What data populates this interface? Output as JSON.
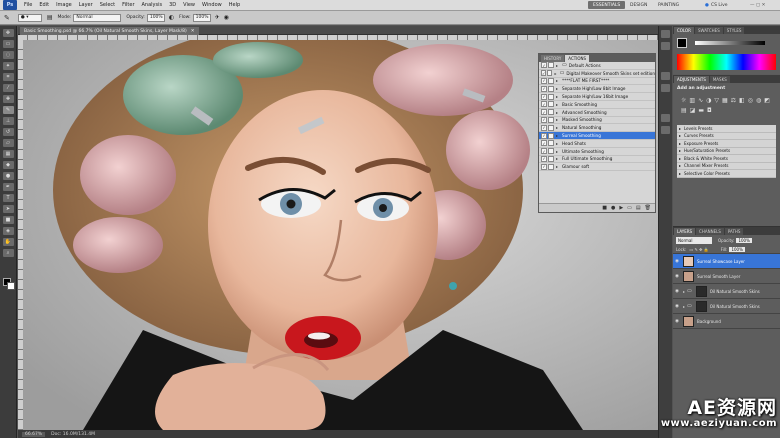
{
  "app": {
    "logo": "Ps",
    "menu": [
      "File",
      "Edit",
      "Image",
      "Layer",
      "Select",
      "Filter",
      "Analysis",
      "3D",
      "View",
      "Window",
      "Help"
    ],
    "workspaces": [
      "ESSENTIALS",
      "DESIGN",
      "PAINTING"
    ],
    "cs_live": "CS Live"
  },
  "options": {
    "mode_label": "Mode:",
    "mode_value": "Normal",
    "opacity_label": "Opacity:",
    "opacity_value": "100%",
    "flow_label": "Flow:",
    "flow_value": "100%"
  },
  "document": {
    "tab_title": "Basic Smoothing.psd @ 66.7% (Oil Natural Smooth Skins, Layer Mask/8)",
    "status_zoom": "66.67%",
    "status_doc": "Doc: 16.0M/131.4M"
  },
  "actions_panel": {
    "tabs": [
      "HISTORY",
      "ACTIONS"
    ],
    "rows": [
      {
        "label": "Default Actions",
        "checked": true,
        "folder": true
      },
      {
        "label": "Digital Makeover Smooth Skins set edition",
        "checked": true,
        "folder": true
      },
      {
        "label": "****FLAT ME FIRST****",
        "checked": true,
        "folder": false
      },
      {
        "label": "Separate High/Low 8bit Image",
        "checked": true,
        "folder": false
      },
      {
        "label": "Separate High/Low 16bit Image",
        "checked": true,
        "folder": false
      },
      {
        "label": "Basic Smoothing",
        "checked": true,
        "folder": false
      },
      {
        "label": "Advanced Smoothing",
        "checked": true,
        "folder": false
      },
      {
        "label": "Masked Smoothing",
        "checked": true,
        "folder": false
      },
      {
        "label": "Natural Smoothing",
        "checked": true,
        "folder": false
      },
      {
        "label": "Surreal Smoothing",
        "checked": true,
        "folder": false,
        "selected": true
      },
      {
        "label": "Head Shots",
        "checked": true,
        "folder": false
      },
      {
        "label": "Ultimate Smoothing",
        "checked": true,
        "folder": false
      },
      {
        "label": "Full Ultimate Smoothing",
        "checked": true,
        "folder": false
      },
      {
        "label": "Glamour soft",
        "checked": true,
        "folder": false
      }
    ],
    "footer_icons": [
      "stop-icon",
      "record-icon",
      "play-icon",
      "new-set-icon",
      "new-action-icon",
      "trash-icon"
    ]
  },
  "color_panel": {
    "tabs": [
      "COLOR",
      "SWATCHES",
      "STYLES"
    ]
  },
  "adjustments_panel": {
    "tabs": [
      "ADJUSTMENTS",
      "MASKS"
    ],
    "title": "Add an adjustment",
    "presets": [
      "Levels Presets",
      "Curves Presets",
      "Exposure Presets",
      "Hue/Saturation Presets",
      "Black & White Presets",
      "Channel Mixer Presets",
      "Selective Color Presets"
    ]
  },
  "layers_panel": {
    "tabs": [
      "LAYERS",
      "CHANNELS",
      "PATHS"
    ],
    "blend_mode": "Normal",
    "opacity_label": "Opacity:",
    "opacity_value": "100%",
    "fill_label": "Fill:",
    "fill_value": "100%",
    "lock_label": "Lock:",
    "layers": [
      {
        "name": "Surreal Showcase Layer",
        "selected": true,
        "group": false
      },
      {
        "name": "Surreal Smooth Layer",
        "selected": false,
        "group": false
      },
      {
        "name": "Oil Natural Smooth Skins",
        "selected": false,
        "group": true
      },
      {
        "name": "Oil Natural Smooth Skins",
        "selected": false,
        "group": true
      },
      {
        "name": "Background",
        "selected": false,
        "group": false
      }
    ]
  },
  "watermark": {
    "line1": "AE资源网",
    "line2": "www.aeziyuan.com"
  },
  "colors": {
    "accent": "#3875d7",
    "panel": "#5d5d5d",
    "menubar": "#dcdcdc"
  }
}
